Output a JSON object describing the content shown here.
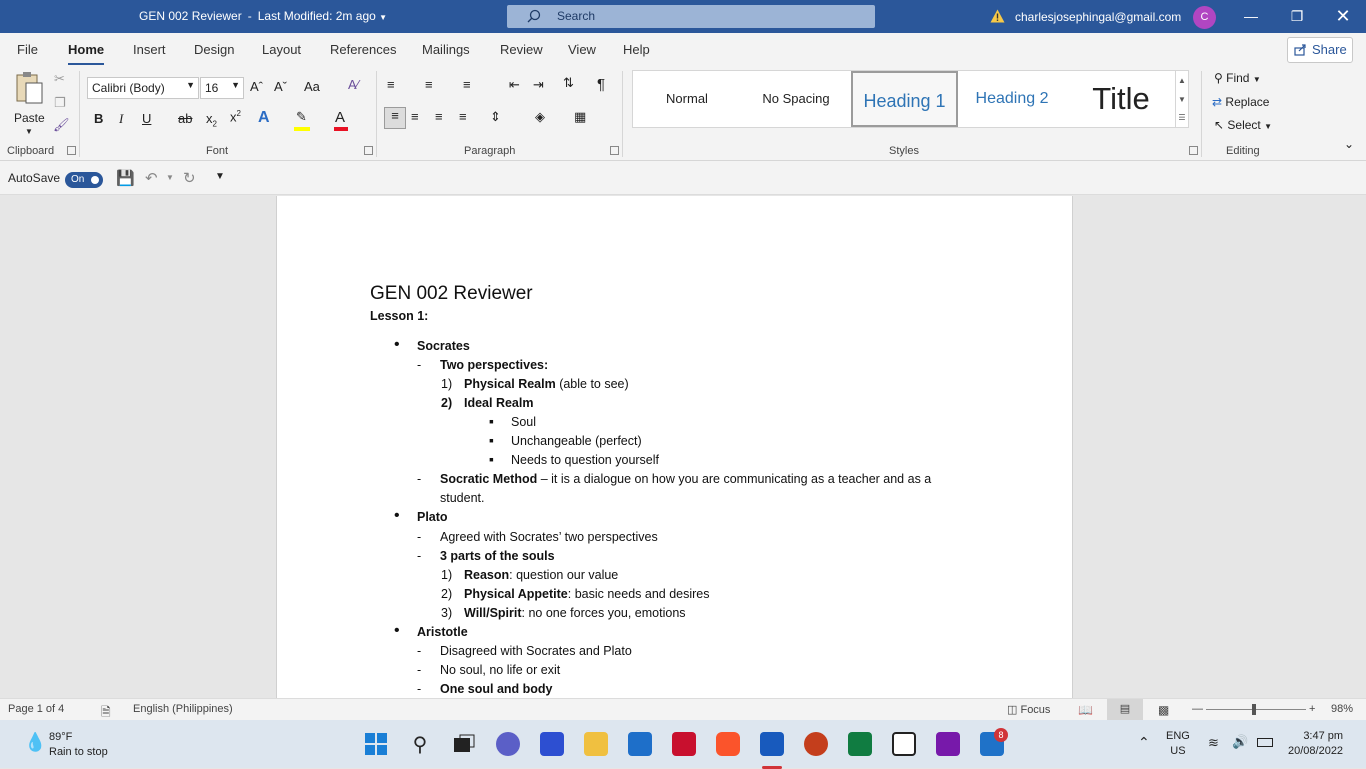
{
  "titlebar": {
    "doc_title": "GEN 002 Reviewer",
    "separator": "-",
    "modified": "Last Modified: 2m ago",
    "search_placeholder": "Search",
    "account_email": "charlesjosephingal@gmail.com",
    "avatar_initial": "C",
    "accent": "#2b579a"
  },
  "menu": {
    "tabs": [
      "File",
      "Home",
      "Insert",
      "Design",
      "Layout",
      "References",
      "Mailings",
      "Review",
      "View",
      "Help"
    ],
    "active": "Home",
    "share_label": "Share"
  },
  "ribbon": {
    "clipboard": {
      "paste_label": "Paste",
      "group_label": "Clipboard"
    },
    "font": {
      "family": "Calibri (Body)",
      "size": "16",
      "bold": "B",
      "italic": "I",
      "underline": "U",
      "strike": "ab",
      "grow": "Aˆ",
      "shrink": "Aˇ",
      "case": "Aa",
      "group_label": "Font",
      "highlight_color": "#ffff00",
      "font_color": "#e81123"
    },
    "paragraph": {
      "group_label": "Paragraph"
    },
    "styles": {
      "items": [
        "Normal",
        "No Spacing",
        "Heading 1",
        "Heading 2",
        "Title"
      ],
      "selected": "Heading 1",
      "group_label": "Styles"
    },
    "editing": {
      "find": "Find",
      "replace": "Replace",
      "select": "Select",
      "group_label": "Editing"
    }
  },
  "qat": {
    "autosave_label": "AutoSave",
    "autosave_state": "On"
  },
  "document": {
    "title": "GEN 002 Reviewer",
    "lesson": "Lesson 1:",
    "lines": [
      {
        "marker": "•",
        "bold": "Socrates",
        "rest": ""
      },
      {
        "marker": "-",
        "bold": "Two perspectives:",
        "rest": ""
      },
      {
        "marker": "1)",
        "bold": "Physical Realm",
        "rest": " (able to see)"
      },
      {
        "marker": "2)",
        "bold": "Ideal Realm",
        "rest": ""
      },
      {
        "marker": "▪",
        "bold": "",
        "rest": "Soul"
      },
      {
        "marker": "▪",
        "bold": "",
        "rest": "Unchangeable (perfect)"
      },
      {
        "marker": "▪",
        "bold": "",
        "rest": "Needs to question yourself"
      },
      {
        "marker": "-",
        "bold": "Socratic Method",
        "rest": " – it is a dialogue on how you are communicating as a teacher and as a"
      },
      {
        "marker": "",
        "bold": "",
        "rest": "student."
      },
      {
        "marker": "•",
        "bold": "Plato",
        "rest": ""
      },
      {
        "marker": "-",
        "bold": "",
        "rest": "Agreed with Socrates’ two perspectives"
      },
      {
        "marker": "-",
        "bold": "3 parts of the souls",
        "rest": ""
      },
      {
        "marker": "1)",
        "bold": "Reason",
        "rest": ": question our value"
      },
      {
        "marker": "2)",
        "bold": "Physical Appetite",
        "rest": ": basic needs and desires"
      },
      {
        "marker": "3)",
        "bold": "Will/Spirit",
        "rest": ": no one forces you, emotions"
      },
      {
        "marker": "•",
        "bold": "Aristotle",
        "rest": ""
      },
      {
        "marker": "-",
        "bold": "",
        "rest": "Disagreed with Socrates and Plato"
      },
      {
        "marker": "-",
        "bold": "",
        "rest": "No soul, no life or exit"
      },
      {
        "marker": "-",
        "bold": "One soul and body",
        "rest": ""
      }
    ]
  },
  "status": {
    "page": "Page 1 of 4",
    "language": "English (Philippines)",
    "focus": "Focus",
    "zoom": "98%"
  },
  "taskbar": {
    "temp": "89°F",
    "weather": "Rain to stop",
    "lang1": "ENG",
    "lang2": "US",
    "time": "3:47 pm",
    "date": "20/08/2022",
    "notif_count": "8"
  }
}
